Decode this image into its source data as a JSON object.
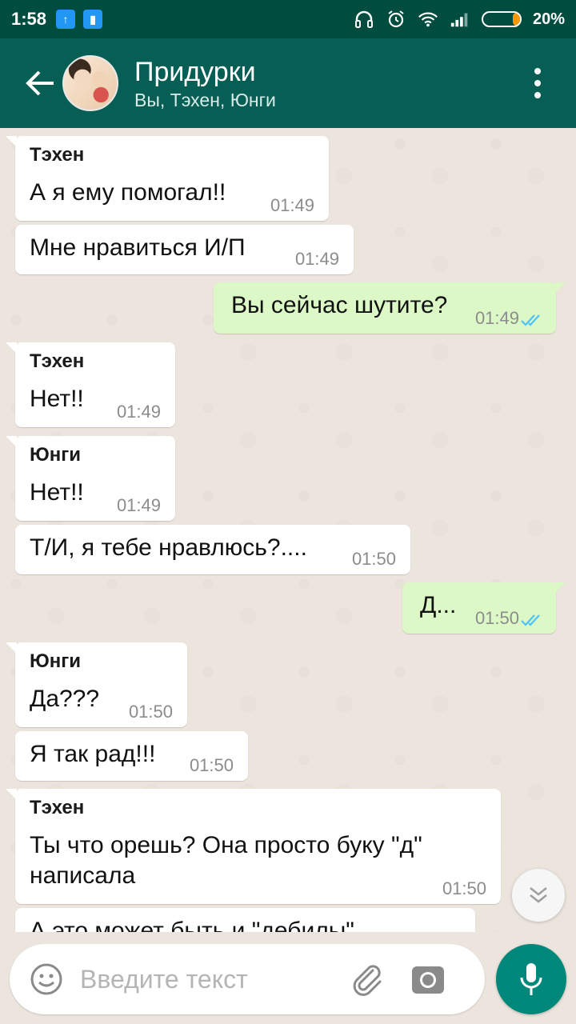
{
  "status_bar": {
    "time": "1:58",
    "battery": "20%",
    "battery_fraction": 0.2
  },
  "header": {
    "title": "Придурки",
    "subtitle": "Вы, Тэхен, Юнги"
  },
  "messages": [
    {
      "direction": "in",
      "sender": "Тэхен",
      "text": "А я ему помогал!!",
      "time": "01:49"
    },
    {
      "direction": "in",
      "sender": "",
      "text": "Мне нравиться И/П",
      "time": "01:49"
    },
    {
      "direction": "out",
      "sender": "",
      "text": "Вы сейчас шутите?",
      "time": "01:49",
      "read": true
    },
    {
      "direction": "in",
      "sender": "Тэхен",
      "text": "Нет!!",
      "time": "01:49"
    },
    {
      "direction": "in",
      "sender": "Юнги",
      "text": "Нет!!",
      "time": "01:49"
    },
    {
      "direction": "in",
      "sender": "",
      "text": "Т/И, я тебе нравлюсь?....",
      "time": "01:50"
    },
    {
      "direction": "out",
      "sender": "",
      "text": "Д...",
      "time": "01:50",
      "read": true
    },
    {
      "direction": "in",
      "sender": "Юнги",
      "text": "Да???",
      "time": "01:50"
    },
    {
      "direction": "in",
      "sender": "",
      "text": "Я так рад!!!",
      "time": "01:50"
    },
    {
      "direction": "in",
      "sender": "Тэхен",
      "text": "Ты что орешь? Она просто буку \"д\" написала",
      "time": "01:50"
    },
    {
      "direction": "in",
      "sender": "",
      "text": "А это может быть и \"дебилы\"",
      "time": ""
    }
  ],
  "composer": {
    "placeholder": "Введите текст"
  },
  "colors": {
    "header": "#075e54",
    "status_bar": "#004d40",
    "outgoing_bubble": "#dcf8c6",
    "incoming_bubble": "#ffffff",
    "read_ticks": "#4fc3f7",
    "mic_button": "#00897b"
  },
  "icons": [
    "back-arrow-icon",
    "more-vert-icon",
    "emoji-icon",
    "paperclip-icon",
    "camera-icon",
    "mic-icon",
    "chevron-down-icon",
    "double-check-icon",
    "headphones-icon",
    "alarm-icon",
    "wifi-icon",
    "signal-icon",
    "battery-icon"
  ]
}
